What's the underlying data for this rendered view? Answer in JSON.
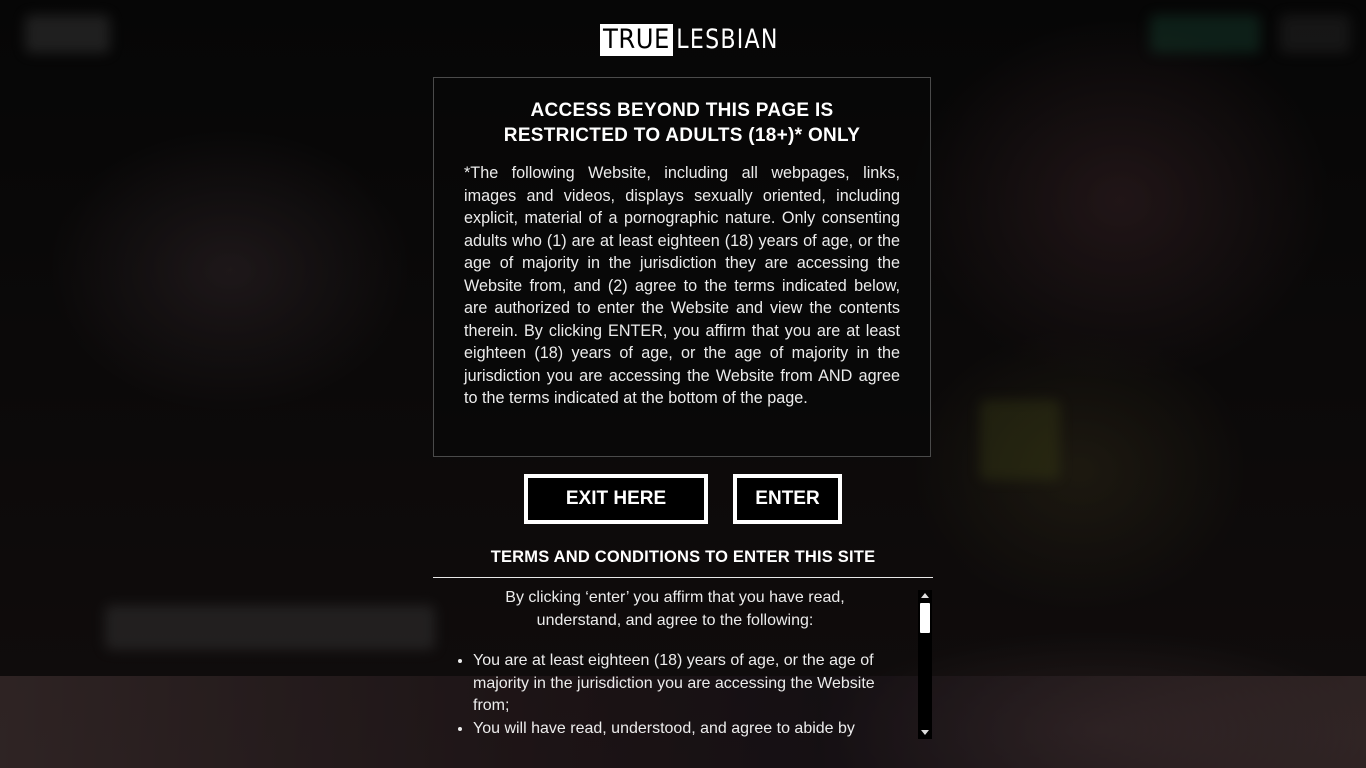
{
  "logo": {
    "part1": "TRUE",
    "part2": "LESBIAN"
  },
  "warning": {
    "title_line1": "ACCESS BEYOND THIS PAGE IS",
    "title_line2": "RESTRICTED TO ADULTS (18+)* ONLY",
    "body": "*The following Website, including all webpages, links, images and videos, displays sexually oriented, including explicit, material of a pornographic nature. Only consenting adults who (1) are at least eighteen (18) years of age, or the age of majority in the jurisdiction they are accessing the Website from, and (2) agree to the terms indicated below, are authorized to enter the Website and view the contents therein. By clicking ENTER, you affirm that you are at least eighteen (18) years of age, or the age of majority in the jurisdiction you are accessing the Website from AND agree to the terms indicated at the bottom of the page."
  },
  "buttons": {
    "exit": "EXIT HERE",
    "enter": "ENTER"
  },
  "terms": {
    "title": "TERMS AND CONDITIONS TO ENTER THIS SITE",
    "intro": "By clicking ‘enter’ you affirm that you have read, understand, and agree to the following:",
    "items": [
      "You are at least eighteen (18) years of age, or the age of majority in the jurisdiction you are accessing the Website from;",
      "You will have read, understood, and agree to abide by"
    ]
  },
  "colors": {
    "background": "#000000",
    "text": "#ffffff",
    "panel_border": "#4a4a4a"
  }
}
